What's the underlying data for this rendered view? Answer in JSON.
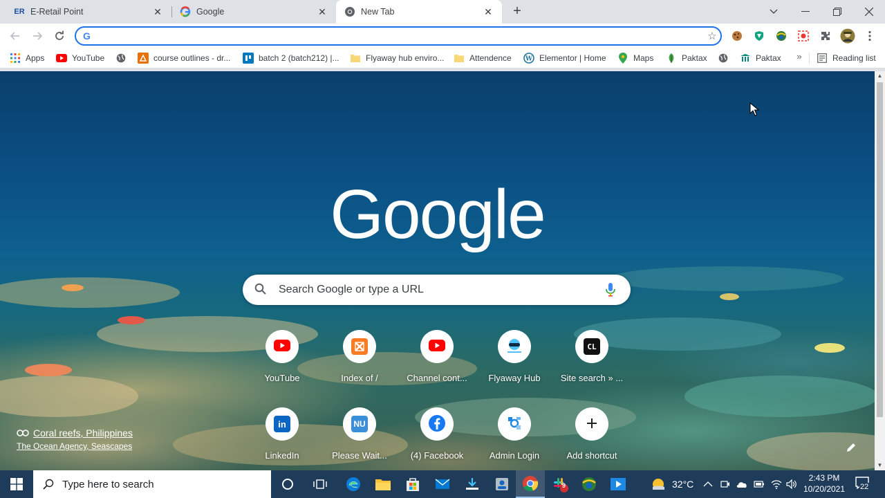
{
  "tabs": [
    {
      "title": "E-Retail Point",
      "favicon": "eretail-icon",
      "active": false
    },
    {
      "title": "Google",
      "favicon": "google-icon",
      "active": false
    },
    {
      "title": "New Tab",
      "favicon": "chrome-icon",
      "active": true
    }
  ],
  "omnibox": {
    "value": "",
    "placeholder": ""
  },
  "bookmarks": [
    {
      "label": "Apps",
      "icon": "apps-grid-icon"
    },
    {
      "label": "YouTube",
      "icon": "youtube-icon"
    },
    {
      "label": "",
      "icon": "globe-icon"
    },
    {
      "label": "course outlines - dr...",
      "icon": "drive-icon"
    },
    {
      "label": "batch 2 (batch212) |...",
      "icon": "trello-icon"
    },
    {
      "label": "Flyaway hub enviro...",
      "icon": "folder-icon"
    },
    {
      "label": "Attendence",
      "icon": "folder-icon"
    },
    {
      "label": "Elementor | Home",
      "icon": "wordpress-icon"
    },
    {
      "label": "Maps",
      "icon": "maps-pin-icon"
    },
    {
      "label": "Paktax",
      "icon": "leaf-icon"
    },
    {
      "label": "",
      "icon": "globe-icon"
    },
    {
      "label": "Paktax",
      "icon": "paktax-icon"
    }
  ],
  "reading_list": "Reading list",
  "ntp": {
    "logo": "Google",
    "search_placeholder": "Search Google or type a URL",
    "shortcuts_row1": [
      {
        "label": "YouTube",
        "icon": "youtube-icon"
      },
      {
        "label": "Index of /",
        "icon": "xampp-icon"
      },
      {
        "label": "Channel cont...",
        "icon": "youtube-icon"
      },
      {
        "label": "Flyaway Hub",
        "icon": "flyaway-icon"
      },
      {
        "label": "Site search » ...",
        "icon": "cl-icon"
      }
    ],
    "shortcuts_row2": [
      {
        "label": "LinkedIn",
        "icon": "linkedin-icon"
      },
      {
        "label": "Please Wait...",
        "icon": "nu-icon"
      },
      {
        "label": "(4) Facebook",
        "icon": "facebook-icon"
      },
      {
        "label": "Admin Login",
        "icon": "admin-icon"
      },
      {
        "label": "Add shortcut",
        "icon": "plus-icon"
      }
    ],
    "attribution_title": "Coral reefs, Philippines",
    "attribution_credit": "The Ocean Agency, Seascapes"
  },
  "taskbar": {
    "search_placeholder": "Type here to search",
    "weather": "32°C",
    "time": "2:43 PM",
    "date": "10/20/2021",
    "notifications": "22",
    "slack_badge": "9"
  },
  "colors": {
    "accent": "#1a73e8",
    "youtube": "#ff0000",
    "facebook": "#1877f2",
    "linkedin": "#0a66c2",
    "taskbar": "#1f3b5a"
  }
}
